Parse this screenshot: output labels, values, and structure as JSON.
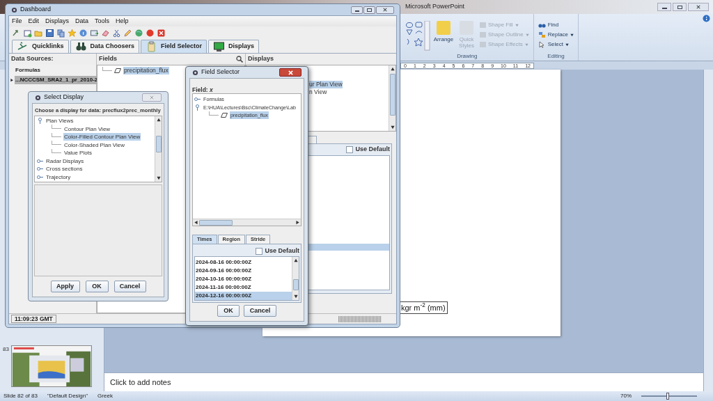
{
  "powerpoint": {
    "title": "Microsoft PowerPoint",
    "ribbon_groups": [
      {
        "label": "Drawing",
        "items": [
          {
            "kind": "large",
            "label": "Arrange",
            "disabled": false
          },
          {
            "kind": "large",
            "label": "Quick Styles",
            "disabled": true
          },
          {
            "kind": "small",
            "label": "Shape Fill",
            "disabled": true
          },
          {
            "kind": "small",
            "label": "Shape Outline",
            "disabled": true
          },
          {
            "kind": "small",
            "label": "Shape Effects",
            "disabled": true
          }
        ]
      },
      {
        "label": "Editing",
        "items": [
          {
            "kind": "small",
            "label": "Find",
            "disabled": false
          },
          {
            "kind": "small",
            "label": "Replace",
            "disabled": false
          },
          {
            "kind": "small",
            "label": "Select",
            "disabled": false
          }
        ]
      }
    ],
    "ruler": [
      "0",
      "1",
      "2",
      "3",
      "4",
      "5",
      "6",
      "7",
      "8",
      "9",
      "10",
      "11",
      "12"
    ],
    "slide_number": "83",
    "slide_text": "kgr m$^{-2}$ (mm)",
    "notes_placeholder": "Click to add notes",
    "status_bar": {
      "slide": "Slide 82 of 83",
      "theme": "\"Default Design\"",
      "language": "Greek",
      "zoom": "70%",
      "zoom_slider": {
        "level": 0.45
      }
    }
  },
  "dashboard": {
    "title": "Dashboard",
    "menu": [
      "File",
      "Edit",
      "Displays",
      "Data",
      "Tools",
      "Help"
    ],
    "tabs": [
      {
        "label": "Quicklinks",
        "selected": false
      },
      {
        "label": "Data Choosers",
        "selected": false
      },
      {
        "label": "Field Selector",
        "selected": true
      },
      {
        "label": "Displays",
        "selected": false
      }
    ],
    "data_sources": {
      "header": "Data Sources:",
      "items": [
        {
          "label": "Formulas",
          "selected": false
        },
        {
          "label": "...NCCCSM_SRA2_1_pr_2010-2",
          "selected": true
        }
      ]
    },
    "fields": {
      "header": "Fields",
      "items": [
        {
          "label": "precipitation_flux",
          "selected": true
        }
      ]
    },
    "displays": {
      "header": "Displays",
      "items": [
        {
          "label": "ur Plan View",
          "selected": true
        },
        {
          "label": "n View",
          "selected": false
        }
      ]
    },
    "use_default": {
      "label": "Use Default",
      "checked": false
    },
    "status_time": "11:09:23 GMT"
  },
  "select_display": {
    "title": "Select Display",
    "prompt": "Choose a display for data: precflux2prec_monthly",
    "tree": [
      {
        "label": "Plan Views",
        "expanded": true,
        "selected": false,
        "children": [
          {
            "label": "Contour Plan View",
            "selected": false
          },
          {
            "label": "Color-Filled Contour Plan View",
            "selected": true
          },
          {
            "label": "Color-Shaded Plan View",
            "selected": false
          },
          {
            "label": "Value Plots",
            "selected": false
          }
        ]
      },
      {
        "label": "Radar Displays",
        "expanded": false,
        "selected": false
      },
      {
        "label": "Cross sections",
        "expanded": false,
        "selected": false
      },
      {
        "label": "Trajectory",
        "expanded": false,
        "selected": false
      }
    ],
    "buttons": [
      "Apply",
      "OK",
      "Cancel"
    ]
  },
  "field_selector": {
    "title": "Field Selector",
    "field_label": "Field: *x*",
    "tree": [
      {
        "label": "Formulas",
        "expanded": false,
        "selected": false
      },
      {
        "label": "E:\\HUA\\Lectures\\Bsc\\ClimateChange\\Lab",
        "expanded": true,
        "selected": false,
        "children": [
          {
            "label": "precipitation_flux",
            "selected": true
          }
        ]
      }
    ],
    "tabs": [
      {
        "label": "Times",
        "selected": true
      },
      {
        "label": "Region",
        "selected": false
      },
      {
        "label": "Stride",
        "selected": false
      }
    ],
    "use_default": {
      "label": "Use Default",
      "checked": false
    },
    "times": [
      {
        "label": "2024-08-16 00:00:00Z",
        "selected": false
      },
      {
        "label": "2024-09-16 00:00:00Z",
        "selected": false
      },
      {
        "label": "2024-10-16 00:00:00Z",
        "selected": false
      },
      {
        "label": "2024-11-16 00:00:00Z",
        "selected": false
      },
      {
        "label": "2024-12-16 00:00:00Z",
        "selected": true
      }
    ],
    "buttons": [
      "OK",
      "Cancel"
    ]
  }
}
